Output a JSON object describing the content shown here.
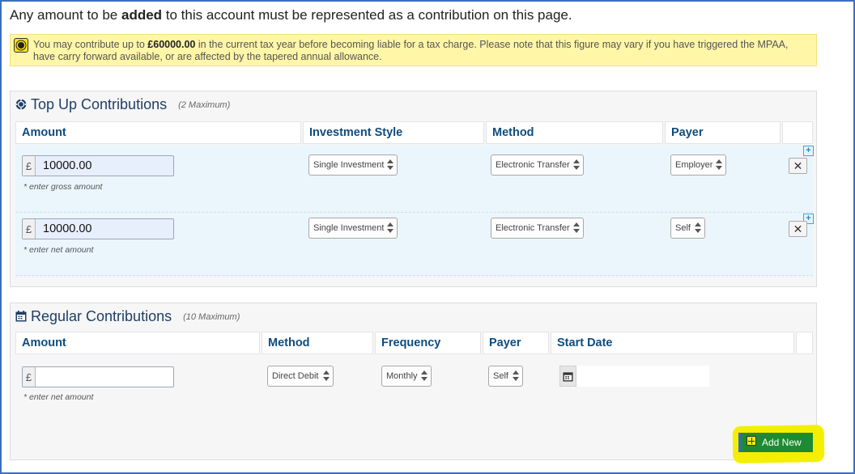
{
  "intro": {
    "before": "Any amount to be ",
    "bold": "added",
    "after": " to this account must be represented as a contribution on this page."
  },
  "notice": {
    "text_before": "You may contribute up to ",
    "amount": "£60000.00",
    "text_after": " in the current tax year before becoming liable for a tax charge. Please note that this figure may vary if you have triggered the MPAA, have carry forward available, or are affected by the tapered annual allowance.",
    "icon": "info-icon"
  },
  "top_up": {
    "title": "Top Up Contributions",
    "subtitle": "(2 Maximum)",
    "icon": "coins-icon",
    "headers": {
      "amount": "Amount",
      "investment_style": "Investment Style",
      "method": "Method",
      "payer": "Payer"
    },
    "rows": [
      {
        "currency": "£",
        "amount": "10000.00",
        "hint": "* enter gross amount",
        "investment_style": "Single Investment",
        "method": "Electronic Transfer",
        "payer": "Employer",
        "remove": "✕",
        "add": "+"
      },
      {
        "currency": "£",
        "amount": "10000.00",
        "hint": "* enter net amount",
        "investment_style": "Single Investment",
        "method": "Electronic Transfer",
        "payer": "Self",
        "remove": "✕",
        "add": "+"
      }
    ]
  },
  "regular": {
    "title": "Regular Contributions",
    "subtitle": "(10 Maximum)",
    "icon": "calendar-icon",
    "headers": {
      "amount": "Amount",
      "method": "Method",
      "frequency": "Frequency",
      "payer": "Payer",
      "start_date": "Start Date"
    },
    "row": {
      "currency": "£",
      "amount": "",
      "hint": "* enter net amount",
      "method": "Direct Debit",
      "frequency": "Monthly",
      "payer": "Self",
      "start_date": ""
    }
  },
  "add_new": {
    "label": "Add New"
  },
  "colors": {
    "frame": "#3c6fbf",
    "header_text": "#0e4c7e",
    "notice_bg": "#fff6a8",
    "row_bg": "#eaf6fc",
    "add_button": "#1e8a34",
    "highlight": "#f4ef00"
  }
}
